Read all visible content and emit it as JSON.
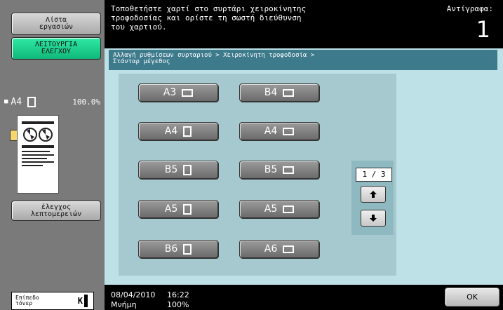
{
  "sidebar": {
    "utility_line1": "Λίστα",
    "utility_line2": "εργασιών",
    "check_line1": "ΛΕΙΤΟΥΡΓΙΑ",
    "check_line2": "ΕΛΕΓΧΟΥ",
    "paper_size": "A4",
    "zoom": "100.0%",
    "detail_line1": "έλεγχος",
    "detail_line2": "λεπτομερειών",
    "toner_line1": "Επίπεδο",
    "toner_line2": "τόνερ",
    "toner_color": "K",
    "toner_level": 1.0
  },
  "header": {
    "message": "Τοποθετήστε χαρτί στο συρτάρι χειροκίνητης\nτροφοδοσίας και ορίστε τη σωστή διεύθυνση\nτου χαρτιού.",
    "copies_label": "Αντίγραφα:",
    "copies_value": "1"
  },
  "breadcrumb": {
    "line1": "Αλλαγή ρυθμίσεων συρταριού > Χειροκίνητη τροφοδοσία >",
    "line2": "Στάνταρ μέγεθος"
  },
  "sizes": [
    {
      "label": "A3",
      "orientation": "landscape"
    },
    {
      "label": "B4",
      "orientation": "landscape"
    },
    {
      "label": "A4",
      "orientation": "portrait"
    },
    {
      "label": "A4",
      "orientation": "landscape"
    },
    {
      "label": "B5",
      "orientation": "portrait"
    },
    {
      "label": "B5",
      "orientation": "landscape"
    },
    {
      "label": "A5",
      "orientation": "portrait"
    },
    {
      "label": "A5",
      "orientation": "landscape"
    },
    {
      "label": "B6",
      "orientation": "portrait"
    },
    {
      "label": "A6",
      "orientation": "landscape"
    }
  ],
  "pager": {
    "indicator": "1 / 3",
    "up_icon": "arrow-up-icon",
    "down_icon": "arrow-down-icon"
  },
  "footer": {
    "date": "08/04/2010",
    "time": "16:22",
    "memory_label": "Μνήμη",
    "memory_value": "100%",
    "ok_label": "OK"
  },
  "colors": {
    "panel_bg": "#bde1e7",
    "breadcrumb_bg": "#3d7a8c",
    "check_button": "#1fd590",
    "sidebar_bg": "#7a7a7a"
  }
}
